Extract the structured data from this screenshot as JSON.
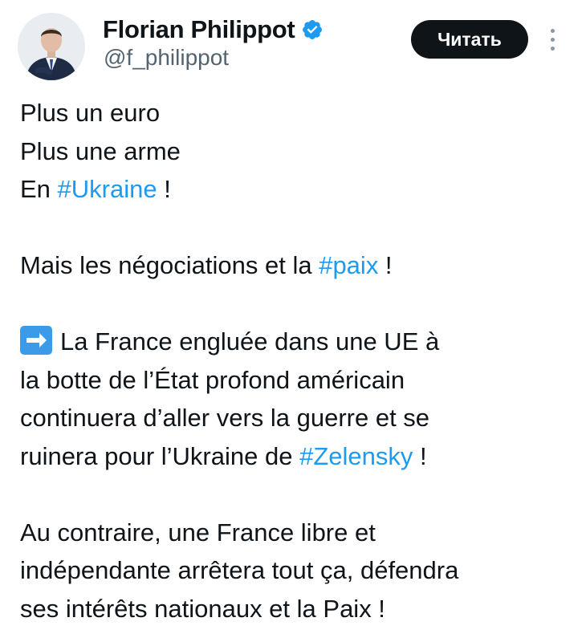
{
  "author": {
    "display_name": "Florian Philippot",
    "handle": "@f_philippot",
    "verified": true,
    "avatar_icon": "profile-photo"
  },
  "actions": {
    "follow_label": "Читать",
    "more_icon": "vertical-ellipsis-icon"
  },
  "colors": {
    "text": "#0f1419",
    "secondary": "#536471",
    "link": "#1d9bf0",
    "verified_badge": "#1d9bf0",
    "button_bg": "#0f1419",
    "button_text": "#ffffff"
  },
  "tweet": {
    "p1": {
      "l1": "Plus un euro",
      "l2": "Plus une arme",
      "l3_pre": "En ",
      "l3_tag": "#Ukraine",
      "l3_post": " !"
    },
    "p2": {
      "pre": "Mais les négociations et la ",
      "tag": "#paix",
      "post": " !"
    },
    "p3": {
      "emoji_icon": "right-arrow-emoji",
      "l1_text": "La France engluée dans une UE à",
      "l2": "la botte de l’État profond américain",
      "l3": "continuera d’aller vers la guerre et se",
      "l4_pre": "ruinera pour l’Ukraine de ",
      "l4_tag": "#Zelensky",
      "l4_post": " !"
    },
    "p4": {
      "l1": "Au contraire, une France libre et",
      "l2": "indépendante arrêtera tout ça, défendra",
      "l3": "ses intérêts nationaux et la Paix !"
    }
  }
}
